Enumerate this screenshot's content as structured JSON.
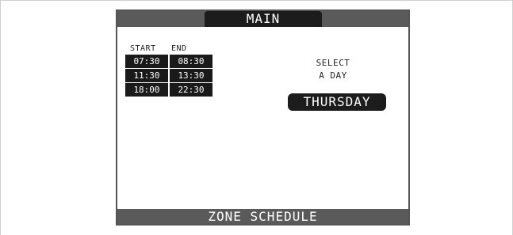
{
  "header": {
    "title": "MAIN"
  },
  "schedule": {
    "start_header": "START",
    "end_header": "END",
    "rows": [
      {
        "start": "07:30",
        "end": "08:30"
      },
      {
        "start": "11:30",
        "end": "13:30"
      },
      {
        "start": "18:00",
        "end": "22:30"
      }
    ]
  },
  "day_selector": {
    "label_line1": "SELECT",
    "label_line2": "A DAY",
    "selected_day": "THURSDAY"
  },
  "footer": {
    "title": "ZONE SCHEDULE"
  },
  "colors": {
    "bar": "#5a5a5a",
    "dark": "#1c1c1c",
    "text_light": "#ffffff"
  }
}
